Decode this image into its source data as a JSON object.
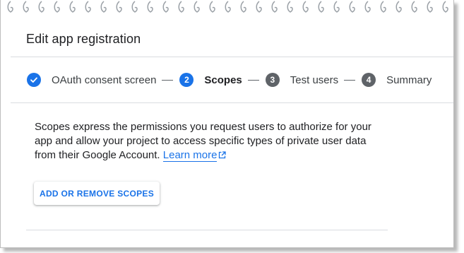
{
  "page": {
    "title": "Edit app registration"
  },
  "stepper": {
    "steps": [
      {
        "number": "",
        "label": "OAuth consent screen",
        "state": "complete"
      },
      {
        "number": "2",
        "label": "Scopes",
        "state": "active"
      },
      {
        "number": "3",
        "label": "Test users",
        "state": "pending"
      },
      {
        "number": "4",
        "label": "Summary",
        "state": "pending"
      }
    ]
  },
  "description": {
    "text": "Scopes express the permissions you request users to authorize for your app and allow your project to access specific types of private user data from their Google Account.",
    "link_label": "Learn more"
  },
  "actions": {
    "add_remove_scopes_label": "ADD OR REMOVE SCOPES"
  },
  "colors": {
    "accent": "#1a73e8",
    "pending_step": "#5f6368",
    "divider": "#dadce0",
    "text": "#202124"
  },
  "icons": {
    "complete_step": "check-circle-icon",
    "learn_more": "open-in-new-icon"
  }
}
